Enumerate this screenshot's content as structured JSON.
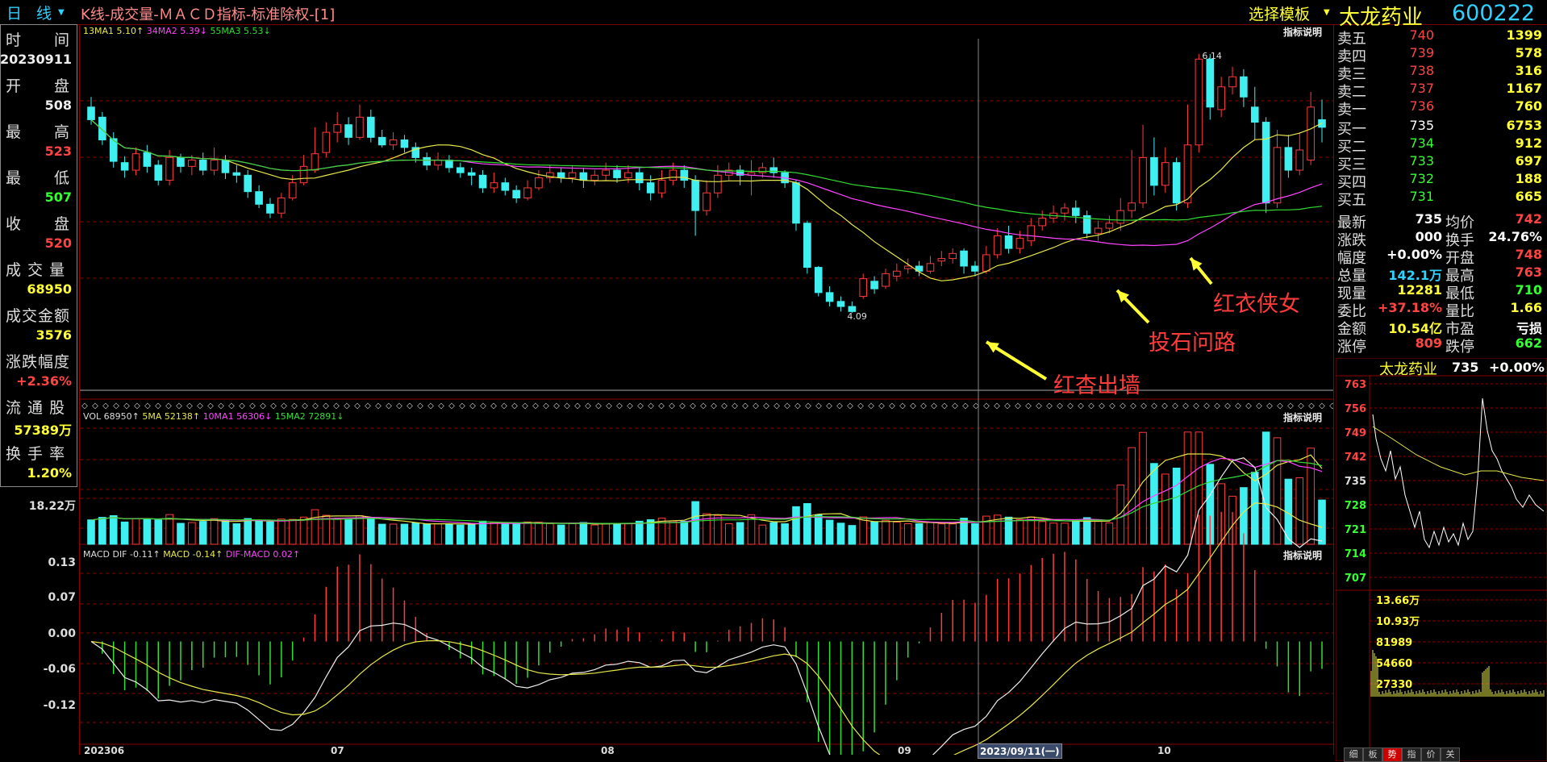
{
  "topbar": {
    "period": "日 线",
    "title": "K线-成交量-ＭＡＣＤ指标-标准除权-[1]",
    "template_btn": "选择模板",
    "stock_name": "太龙药业",
    "stock_code": "600222"
  },
  "left_panel": {
    "items": [
      {
        "label": "时　　间",
        "value": "20230911"
      },
      {
        "label": "开　　盘",
        "value": "508"
      },
      {
        "label": "最　　高",
        "value": "523"
      },
      {
        "label": "最　　低",
        "value": "507"
      },
      {
        "label": "收　　盘",
        "value": "520"
      },
      {
        "label": "成 交 量",
        "value": "68950"
      },
      {
        "label": "成交金额",
        "value": "3576"
      },
      {
        "label": "涨跌幅度",
        "value": "+2.36%"
      },
      {
        "label": "流 通 股",
        "value": "57389万"
      },
      {
        "label": "换 手 率",
        "value": "1.20%"
      }
    ]
  },
  "kline": {
    "ma_title": "13MA1 5.10↑ 34MA2 5.39↓ 55MA3 5.53↓",
    "ma_parts": [
      "13MA1 5.10↑",
      "34MA2 5.39↓",
      "55MA3 5.53↓"
    ],
    "help": "指标说明",
    "high_label": "6.14",
    "low_label": "4.09",
    "annotations": [
      "红杏出墙",
      "投石问路",
      "红衣侠女"
    ]
  },
  "volume": {
    "title_parts": [
      "VOL 68950↑",
      "5MA 52138↑",
      "10MA1 56306↓",
      "15MA2 72891↓"
    ],
    "help": "指标说明",
    "y_top": "18.22万"
  },
  "macd": {
    "title_parts": [
      "MACD DIF -0.11↑",
      "MACD -0.14↑",
      "DIF-MACD 0.02↑"
    ],
    "help": "指标说明",
    "y_labels": [
      "0.13",
      "0.07",
      "0.00",
      "-0.06",
      "-0.12"
    ]
  },
  "x_axis": {
    "labels": [
      "202306",
      "07",
      "08",
      "09",
      "10"
    ],
    "cursor_date": "2023/09/11(一)"
  },
  "quotes": {
    "sell": [
      {
        "label": "卖五",
        "price": "740",
        "vol": "1399"
      },
      {
        "label": "卖四",
        "price": "739",
        "vol": "578"
      },
      {
        "label": "卖三",
        "price": "738",
        "vol": "316"
      },
      {
        "label": "卖二",
        "price": "737",
        "vol": "1167"
      },
      {
        "label": "卖一",
        "price": "736",
        "vol": "760"
      }
    ],
    "buy": [
      {
        "label": "买一",
        "price": "735",
        "vol": "6753"
      },
      {
        "label": "买二",
        "price": "734",
        "vol": "912"
      },
      {
        "label": "买三",
        "price": "733",
        "vol": "697"
      },
      {
        "label": "买四",
        "price": "732",
        "vol": "188"
      },
      {
        "label": "买五",
        "price": "731",
        "vol": "665"
      }
    ]
  },
  "stats": [
    {
      "l1": "最新",
      "v1": "735",
      "l2": "均价",
      "v2": "742"
    },
    {
      "l1": "涨跌",
      "v1": "000",
      "l2": "换手",
      "v2": "24.76%"
    },
    {
      "l1": "幅度",
      "v1": "+0.00%",
      "l2": "开盘",
      "v2": "748"
    },
    {
      "l1": "总量",
      "v1": "142.1万",
      "l2": "最高",
      "v2": "763"
    },
    {
      "l1": "现量",
      "v1": "12281",
      "l2": "最低",
      "v2": "710"
    },
    {
      "l1": "委比",
      "v1": "+37.18%",
      "l2": "量比",
      "v2": "1.66"
    },
    {
      "l1": "金额",
      "v1": "10.54亿",
      "l2": "市盈",
      "v2": "亏损"
    },
    {
      "l1": "涨停",
      "v1": "809",
      "l2": "跌停",
      "v2": "662"
    }
  ],
  "mini": {
    "name": "太龙药业",
    "price": "735",
    "pct": "+0.00%",
    "price_labels": [
      "763",
      "756",
      "749",
      "742",
      "735",
      "728",
      "721",
      "714",
      "707"
    ],
    "vol_labels": [
      "13.66万",
      "10.93万",
      "81989",
      "54660",
      "27330"
    ]
  },
  "tabs": [
    "细",
    "板",
    "势",
    "指",
    "价",
    "关"
  ],
  "colors": {
    "up": "#ff3b3b",
    "down": "#40f0f0",
    "ma13": "#e8e84a",
    "ma34": "#ff44ff",
    "ma55": "#33dd33",
    "yellow": "#ffff33"
  },
  "chart_data": [
    {
      "type": "candlestick",
      "title": "K线",
      "ylim": [
        4.0,
        6.3
      ],
      "high_marker": 6.14,
      "low_marker": 4.09,
      "candles": [
        [
          5.72,
          5.62,
          5.8,
          5.58
        ],
        [
          5.64,
          5.46,
          5.68,
          5.42
        ],
        [
          5.47,
          5.29,
          5.52,
          5.24
        ],
        [
          5.28,
          5.22,
          5.33,
          5.16
        ],
        [
          5.22,
          5.35,
          5.4,
          5.18
        ],
        [
          5.36,
          5.25,
          5.42,
          5.2
        ],
        [
          5.26,
          5.14,
          5.3,
          5.1
        ],
        [
          5.14,
          5.32,
          5.38,
          5.1
        ],
        [
          5.32,
          5.25,
          5.35,
          5.2
        ],
        [
          5.25,
          5.3,
          5.34,
          5.18
        ],
        [
          5.3,
          5.22,
          5.36,
          5.18
        ],
        [
          5.22,
          5.3,
          5.4,
          5.18
        ],
        [
          5.3,
          5.2,
          5.34,
          5.15
        ],
        [
          5.2,
          5.18,
          5.26,
          5.12
        ],
        [
          5.18,
          5.05,
          5.22,
          5.0
        ],
        [
          5.05,
          4.95,
          5.1,
          4.92
        ],
        [
          4.95,
          4.88,
          5.0,
          4.84
        ],
        [
          4.88,
          5.0,
          5.04,
          4.84
        ],
        [
          5.0,
          5.12,
          5.18,
          4.98
        ],
        [
          5.12,
          5.25,
          5.34,
          5.1
        ],
        [
          5.22,
          5.35,
          5.56,
          5.2
        ],
        [
          5.36,
          5.52,
          5.6,
          5.32
        ],
        [
          5.52,
          5.58,
          5.68,
          5.44
        ],
        [
          5.58,
          5.48,
          5.64,
          5.42
        ],
        [
          5.48,
          5.64,
          5.74,
          5.46
        ],
        [
          5.64,
          5.48,
          5.7,
          5.44
        ],
        [
          5.48,
          5.42,
          5.54,
          5.4
        ],
        [
          5.42,
          5.46,
          5.52,
          5.38
        ],
        [
          5.46,
          5.4,
          5.5,
          5.36
        ],
        [
          5.4,
          5.32,
          5.44,
          5.28
        ],
        [
          5.32,
          5.26,
          5.36,
          5.22
        ],
        [
          5.26,
          5.3,
          5.36,
          5.22
        ],
        [
          5.3,
          5.24,
          5.34,
          5.2
        ],
        [
          5.24,
          5.2,
          5.28,
          5.16
        ],
        [
          5.2,
          5.18,
          5.24,
          5.1
        ],
        [
          5.18,
          5.08,
          5.22,
          5.04
        ],
        [
          5.08,
          5.12,
          5.2,
          5.04
        ],
        [
          5.12,
          5.06,
          5.16,
          5.02
        ],
        [
          5.06,
          5.0,
          5.1,
          4.96
        ],
        [
          5.0,
          5.08,
          5.14,
          4.98
        ],
        [
          5.08,
          5.16,
          5.22,
          5.06
        ],
        [
          5.16,
          5.2,
          5.26,
          5.12
        ],
        [
          5.2,
          5.16,
          5.24,
          5.12
        ],
        [
          5.16,
          5.2,
          5.26,
          5.12
        ],
        [
          5.2,
          5.14,
          5.24,
          5.08
        ],
        [
          5.14,
          5.18,
          5.22,
          5.1
        ],
        [
          5.18,
          5.22,
          5.28,
          5.14
        ],
        [
          5.22,
          5.16,
          5.26,
          5.12
        ],
        [
          5.16,
          5.2,
          5.26,
          5.12
        ],
        [
          5.2,
          5.12,
          5.24,
          5.06
        ],
        [
          5.12,
          5.04,
          5.18,
          4.98
        ],
        [
          5.04,
          5.14,
          5.22,
          5.0
        ],
        [
          5.14,
          5.22,
          5.28,
          5.1
        ],
        [
          5.22,
          5.14,
          5.26,
          5.08
        ],
        [
          5.14,
          4.9,
          5.18,
          4.7
        ],
        [
          4.9,
          5.04,
          5.14,
          4.86
        ],
        [
          5.04,
          5.18,
          5.26,
          5.0
        ],
        [
          5.18,
          5.22,
          5.28,
          5.14
        ],
        [
          5.22,
          5.18,
          5.26,
          5.1
        ],
        [
          5.18,
          5.2,
          5.3,
          5.02
        ],
        [
          5.2,
          5.24,
          5.28,
          5.16
        ],
        [
          5.24,
          5.2,
          5.32,
          5.16
        ],
        [
          5.2,
          5.12,
          5.22,
          5.08
        ],
        [
          5.12,
          4.8,
          5.14,
          4.74
        ],
        [
          4.8,
          4.45,
          4.82,
          4.4
        ],
        [
          4.45,
          4.25,
          4.46,
          4.22
        ],
        [
          4.25,
          4.18,
          4.3,
          4.14
        ],
        [
          4.18,
          4.14,
          4.22,
          4.1
        ],
        [
          4.14,
          4.1,
          4.18,
          4.09
        ],
        [
          4.22,
          4.36,
          4.4,
          4.2
        ],
        [
          4.34,
          4.28,
          4.38,
          4.24
        ],
        [
          4.3,
          4.4,
          4.44,
          4.28
        ],
        [
          4.38,
          4.42,
          4.48,
          4.34
        ],
        [
          4.44,
          4.46,
          4.52,
          4.4
        ],
        [
          4.46,
          4.42,
          4.5,
          4.38
        ],
        [
          4.42,
          4.48,
          4.54,
          4.4
        ],
        [
          4.5,
          4.52,
          4.58,
          4.46
        ],
        [
          4.52,
          4.56,
          4.6,
          4.48
        ],
        [
          4.58,
          4.46,
          4.6,
          4.4
        ],
        [
          4.46,
          4.42,
          4.5,
          4.38
        ],
        [
          4.42,
          4.55,
          4.62,
          4.4
        ],
        [
          4.55,
          4.7,
          4.76,
          4.52
        ],
        [
          4.7,
          4.6,
          4.78,
          4.56
        ],
        [
          4.6,
          4.68,
          4.74,
          4.56
        ],
        [
          4.66,
          4.78,
          4.84,
          4.62
        ],
        [
          4.78,
          4.84,
          4.9,
          4.74
        ],
        [
          4.84,
          4.88,
          4.94,
          4.8
        ],
        [
          4.88,
          4.92,
          4.96,
          4.82
        ],
        [
          4.92,
          4.86,
          4.98,
          4.8
        ],
        [
          4.86,
          4.72,
          4.9,
          4.68
        ],
        [
          4.72,
          4.76,
          4.82,
          4.66
        ],
        [
          4.76,
          4.8,
          4.86,
          4.72
        ],
        [
          4.8,
          4.9,
          5.0,
          4.74
        ],
        [
          4.9,
          4.96,
          5.38,
          4.84
        ],
        [
          4.96,
          5.32,
          5.58,
          4.92
        ],
        [
          5.32,
          5.1,
          5.48,
          5.02
        ],
        [
          5.1,
          5.28,
          5.4,
          5.04
        ],
        [
          5.28,
          4.96,
          5.32,
          4.9
        ],
        [
          4.96,
          5.42,
          5.74,
          4.92
        ],
        [
          5.42,
          6.1,
          6.14,
          5.36
        ],
        [
          6.1,
          5.72,
          6.14,
          5.62
        ],
        [
          5.7,
          5.88,
          5.96,
          5.64
        ],
        [
          5.88,
          5.96,
          6.04,
          5.82
        ],
        [
          5.96,
          5.8,
          6.02,
          5.72
        ],
        [
          5.72,
          5.6,
          5.88,
          5.46
        ],
        [
          5.6,
          4.96,
          5.64,
          4.88
        ],
        [
          4.96,
          5.4,
          5.54,
          4.92
        ],
        [
          5.4,
          5.22,
          5.5,
          5.16
        ],
        [
          5.22,
          5.38,
          5.52,
          5.18
        ],
        [
          5.3,
          5.72,
          5.84,
          5.26
        ],
        [
          5.62,
          5.56,
          5.78,
          5.44
        ]
      ],
      "ma_last": {
        "MA13": 5.1,
        "MA34": 5.39,
        "MA55": 5.53
      }
    },
    {
      "type": "bar",
      "title": "VOL",
      "ylim": [
        0,
        182200
      ],
      "last": 68950,
      "ma_last": {
        "5MA": 52138,
        "10MA1": 56306,
        "15MA2": 72891
      }
    },
    {
      "type": "line",
      "title": "MACD",
      "ylim": [
        -0.17,
        0.13
      ],
      "last": {
        "DIF": -0.11,
        "MACD": -0.14,
        "DIF-MACD": 0.02
      }
    }
  ]
}
